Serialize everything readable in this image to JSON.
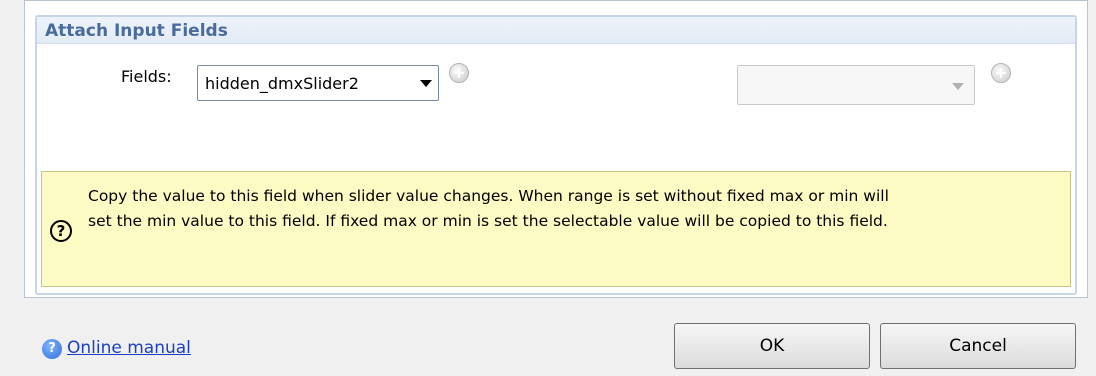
{
  "section": {
    "title": "Attach Input Fields"
  },
  "fields": {
    "label": "Fields:",
    "selected": "hidden_dmxSlider2",
    "second_selected": ""
  },
  "info": {
    "line1": "Copy the value to this field when slider value changes. When range is set without fixed max or min will",
    "line2": "set the min value to this field. If fixed max or min is set the selectable value will be copied to this field.",
    "icon_glyph": "?"
  },
  "footer": {
    "manual_link": "Online manual",
    "ok_label": "OK",
    "cancel_label": "Cancel"
  },
  "colors": {
    "section_title": "#4a6c9c",
    "info_bg": "#fbfbc3",
    "link": "#1a3fc7"
  }
}
